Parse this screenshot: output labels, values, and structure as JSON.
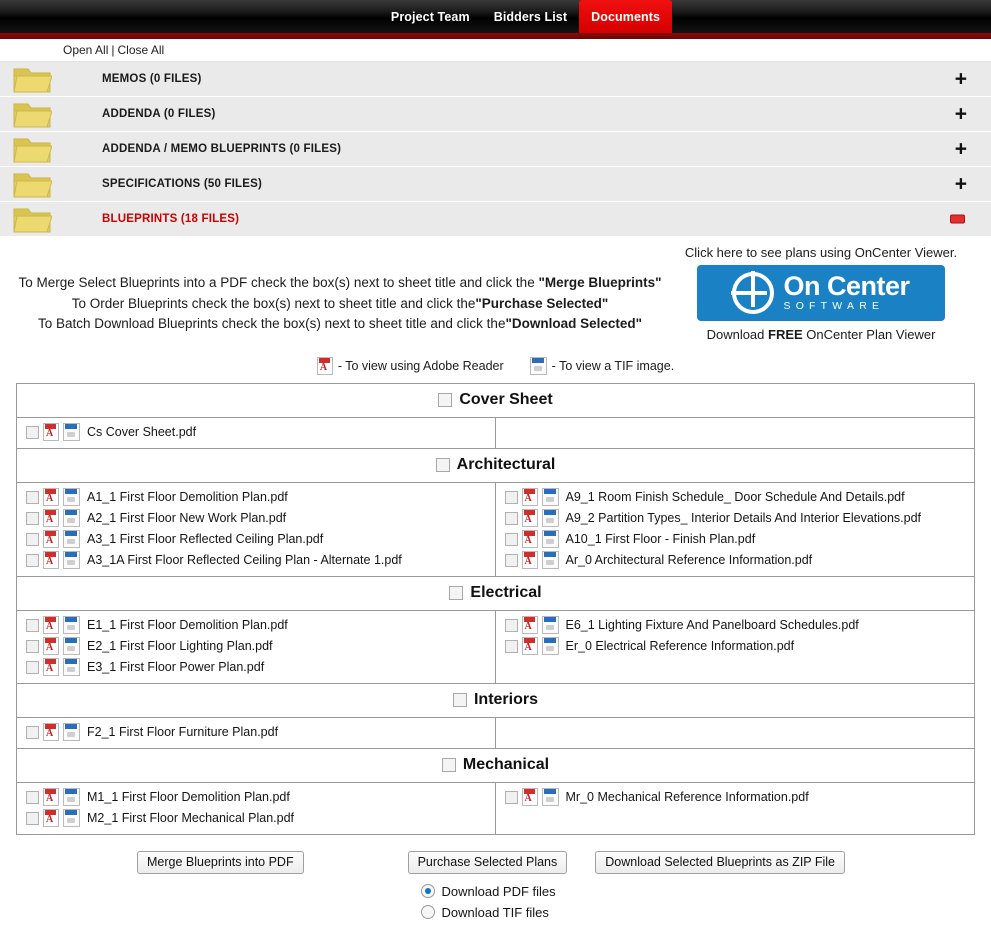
{
  "nav": {
    "tabs": [
      {
        "label": "Project Team",
        "active": false
      },
      {
        "label": "Bidders List",
        "active": false
      },
      {
        "label": "Documents",
        "active": true
      }
    ],
    "accent_color": "#e00000",
    "underline_color": "#8d0b0b"
  },
  "tree_controls": {
    "open_all": "Open All",
    "separator": "|",
    "close_all": "Close All"
  },
  "folders": [
    {
      "label": "MEMOS  (0 FILES)",
      "state": "collapsed",
      "toggle": "+",
      "open": false
    },
    {
      "label": "ADDENDA  (0 FILES)",
      "state": "collapsed",
      "toggle": "+",
      "open": false
    },
    {
      "label": "ADDENDA / MEMO BLUEPRINTS  (0 FILES)",
      "state": "collapsed",
      "toggle": "+",
      "open": false
    },
    {
      "label": "SPECIFICATIONS  (50 FILES)",
      "state": "collapsed",
      "toggle": "+",
      "open": false
    },
    {
      "label": "BLUEPRINTS  (18 FILES)",
      "state": "expanded",
      "toggle": "-",
      "open": true
    }
  ],
  "instructions": {
    "line1_a": "To Merge Select Blueprints into a PDF check the box(s) next to sheet title and click the ",
    "line1_b": "\"Merge Blueprints\"",
    "line2_a": "To Order Blueprints check the box(s) next to sheet title and click the",
    "line2_b": "\"Purchase Selected\"",
    "line3_a": "To Batch Download Blueprints check the box(s) next to sheet title and click the",
    "line3_b": "\"Download Selected\""
  },
  "oncenter": {
    "top_text": "Click here to see plans using OnCenter Viewer.",
    "logo_name": "On Center",
    "logo_sub": "SOFTWARE",
    "bottom_a": "Download ",
    "bottom_b": "FREE",
    "bottom_c": " OnCenter Plan Viewer",
    "brand_color": "#1a82c4"
  },
  "legend": {
    "pdf_text": "- To view using Adobe Reader",
    "tif_text": "- To view a TIF image."
  },
  "sections": [
    {
      "title": "Cover Sheet",
      "left": [
        "Cs Cover Sheet.pdf"
      ],
      "right": []
    },
    {
      "title": "Architectural",
      "left": [
        "A1_1 First Floor Demolition Plan.pdf",
        "A2_1 First Floor New Work Plan.pdf",
        "A3_1 First Floor Reflected Ceiling Plan.pdf",
        "A3_1A First Floor Reflected Ceiling Plan - Alternate 1.pdf"
      ],
      "right": [
        "A9_1 Room Finish Schedule_ Door Schedule And Details.pdf",
        "A9_2 Partition Types_ Interior Details And Interior Elevations.pdf",
        "A10_1 First Floor - Finish Plan.pdf",
        "Ar_0 Architectural Reference Information.pdf"
      ]
    },
    {
      "title": "Electrical",
      "left": [
        "E1_1 First Floor Demolition Plan.pdf",
        "E2_1 First Floor Lighting Plan.pdf",
        "E3_1 First Floor Power Plan.pdf"
      ],
      "right": [
        "E6_1 Lighting Fixture And Panelboard Schedules.pdf",
        "Er_0 Electrical Reference Information.pdf"
      ]
    },
    {
      "title": "Interiors",
      "left": [
        "F2_1 First Floor Furniture Plan.pdf"
      ],
      "right": []
    },
    {
      "title": "Mechanical",
      "left": [
        "M1_1 First Floor Demolition Plan.pdf",
        "M2_1 First Floor Mechanical Plan.pdf"
      ],
      "right": [
        "Mr_0 Mechanical Reference Information.pdf"
      ]
    }
  ],
  "actions": {
    "merge": "Merge Blueprints into PDF",
    "purchase": "Purchase Selected Plans",
    "download": "Download Selected Blueprints as ZIP File"
  },
  "download_format": {
    "options": [
      {
        "label": "Download PDF files",
        "selected": true
      },
      {
        "label": "Download TIF files",
        "selected": false
      }
    ]
  }
}
